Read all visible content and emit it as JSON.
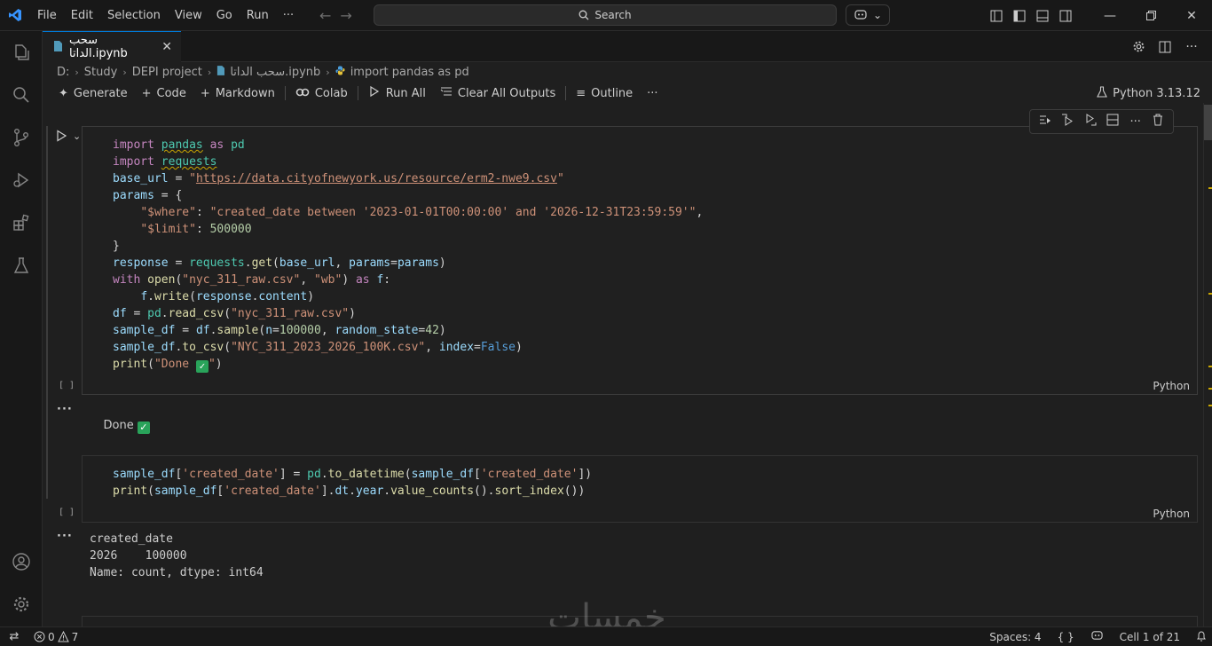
{
  "menu": [
    "File",
    "Edit",
    "Selection",
    "View",
    "Go",
    "Run",
    "···"
  ],
  "search": {
    "label": "Search"
  },
  "tab": {
    "filename": "سحب الداتا.ipynb"
  },
  "breadcrumb": [
    "D:",
    "Study",
    "DEPI project",
    "سحب الداتا.ipynb",
    "import pandas as pd"
  ],
  "toolbar": {
    "generate": "Generate",
    "code": "Code",
    "markdown": "Markdown",
    "colab": "Colab",
    "run_all": "Run All",
    "clear_all_outputs": "Clear All Outputs",
    "outline": "Outline",
    "more": "···"
  },
  "kernel": "Python 3.13.12",
  "cells": [
    {
      "exec_count": "[ ]",
      "language": "Python",
      "output": "Done"
    },
    {
      "exec_count": "[ ]",
      "language": "Python",
      "output_lines": [
        "created_date",
        "2026    100000",
        "Name: count, dtype: int64"
      ]
    }
  ],
  "output_more": "···",
  "status": {
    "errors": "0",
    "warnings": "7",
    "spaces": "Spaces: 4",
    "braces": "{ }",
    "cell_position": "Cell 1 of 21"
  },
  "watermark": "خمسات",
  "colors": {
    "accent": "#0078d4",
    "keyword": "#c586c0",
    "function": "#dcdcaa",
    "string": "#ce9178",
    "number": "#b5cea8",
    "variable": "#9cdcfe",
    "check": "#29a35a"
  },
  "icons": [
    "vscode-logo",
    "arrow-left-icon",
    "arrow-right-icon",
    "search-icon",
    "copilot-icon",
    "layout-icon",
    "explorer-icon",
    "source-control-icon",
    "run-debug-icon",
    "extensions-icon",
    "testing-icon",
    "account-icon",
    "settings-icon"
  ]
}
